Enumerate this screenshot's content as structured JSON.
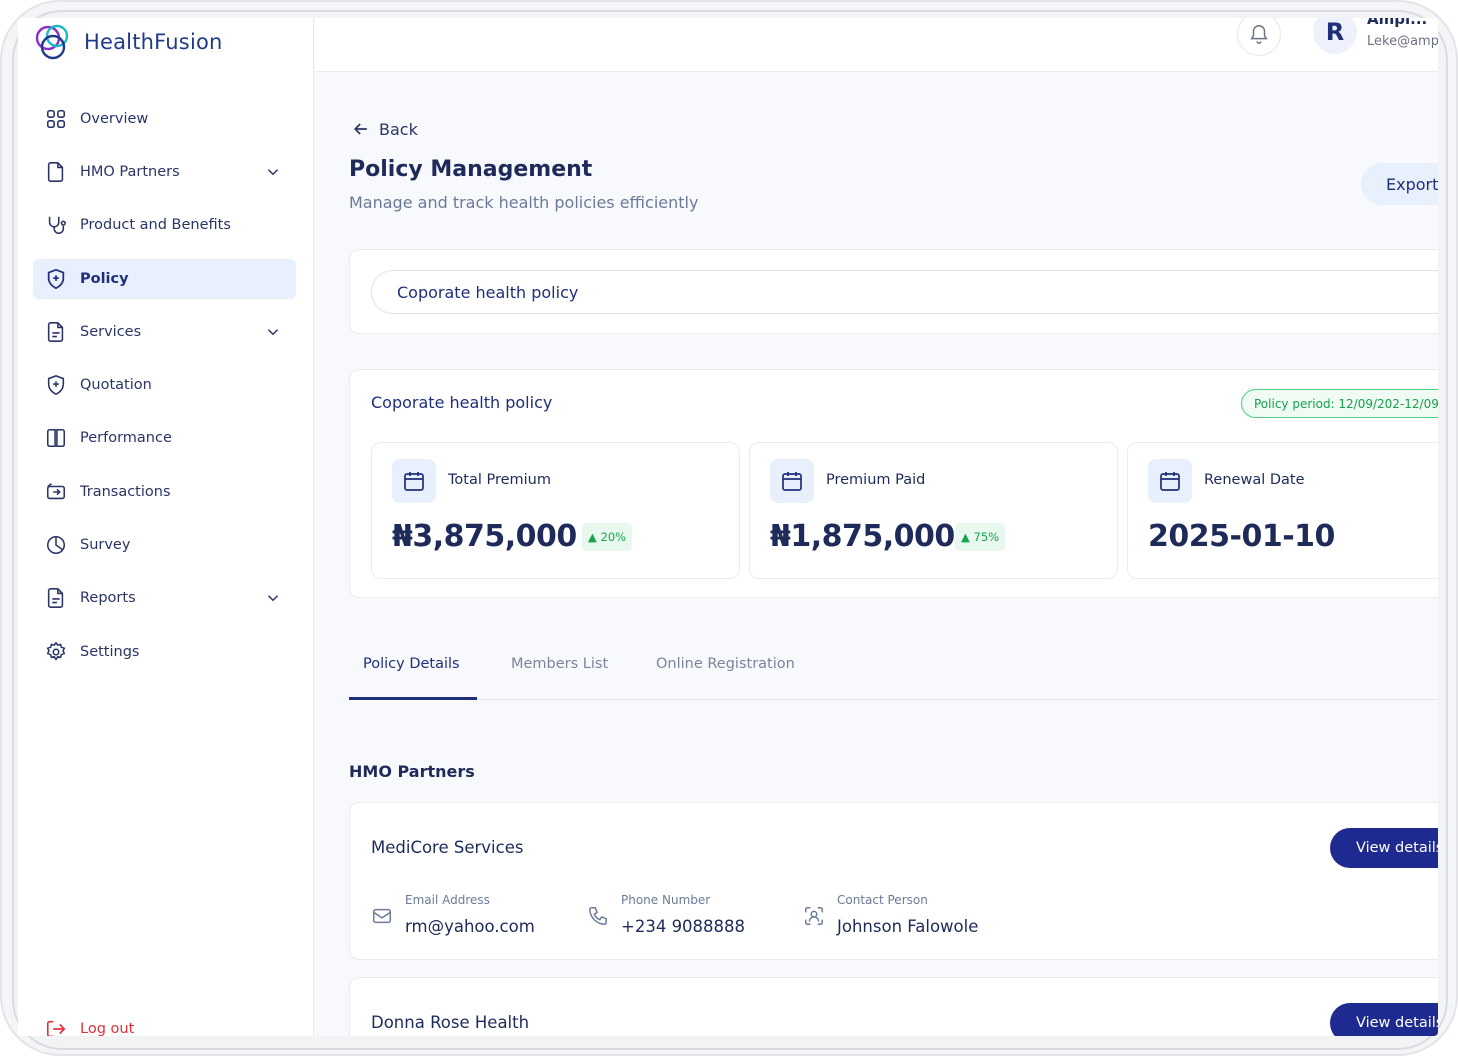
{
  "app": {
    "name": "HealthFusion"
  },
  "sidebar": {
    "items": [
      {
        "label": "Overview",
        "icon": "grid-icon"
      },
      {
        "label": "HMO Partners",
        "icon": "file-icon",
        "expandable": true
      },
      {
        "label": "Product and Benefits",
        "icon": "stethoscope-icon"
      },
      {
        "label": "Policy",
        "icon": "shield-plus-icon",
        "active": true
      },
      {
        "label": "Services",
        "icon": "document-icon",
        "expandable": true
      },
      {
        "label": "Quotation",
        "icon": "shield-plus-icon"
      },
      {
        "label": "Performance",
        "icon": "book-icon"
      },
      {
        "label": "Transactions",
        "icon": "transfer-icon"
      },
      {
        "label": "Survey",
        "icon": "pie-chart-icon"
      },
      {
        "label": "Reports",
        "icon": "document-icon",
        "expandable": true
      },
      {
        "label": "Settings",
        "icon": "gear-icon"
      }
    ],
    "logout_label": "Log out"
  },
  "header": {
    "avatar_initial": "R",
    "user_name": "Ampl...",
    "user_email": "Leke@amp"
  },
  "page": {
    "back_label": "Back",
    "title": "Policy Management",
    "subtitle": "Manage and track health policies efficiently",
    "export_label": "Export",
    "policy_select_value": "Coporate health policy"
  },
  "summary": {
    "title": "Coporate health policy",
    "period_badge": "Policy period: 12/09/202-12/09",
    "stats": [
      {
        "label": "Total Premium",
        "value": "₦3,875,000",
        "delta": "▲ 20%"
      },
      {
        "label": "Premium Paid",
        "value": "₦1,875,000",
        "delta": "▲ 75%"
      },
      {
        "label": "Renewal Date",
        "value": "2025-01-10"
      }
    ]
  },
  "tabs": [
    {
      "label": "Policy  Details",
      "active": true
    },
    {
      "label": "Members List"
    },
    {
      "label": "Online Registration"
    }
  ],
  "hmo_section": {
    "title": "HMO Partners",
    "view_label": "View details",
    "partners": [
      {
        "name": "MediCore Services",
        "email_caption": "Email Address",
        "email": "rm@yahoo.com",
        "phone_caption": "Phone  Number",
        "phone": "+234 9088888",
        "contact_caption": "Contact Person",
        "contact": "Johnson Falowole"
      },
      {
        "name": "Donna Rose Health"
      }
    ]
  },
  "colors": {
    "primary": "#1e2a8f",
    "accent_light": "#e8effd",
    "success": "#16a34a",
    "danger": "#e0323c"
  }
}
